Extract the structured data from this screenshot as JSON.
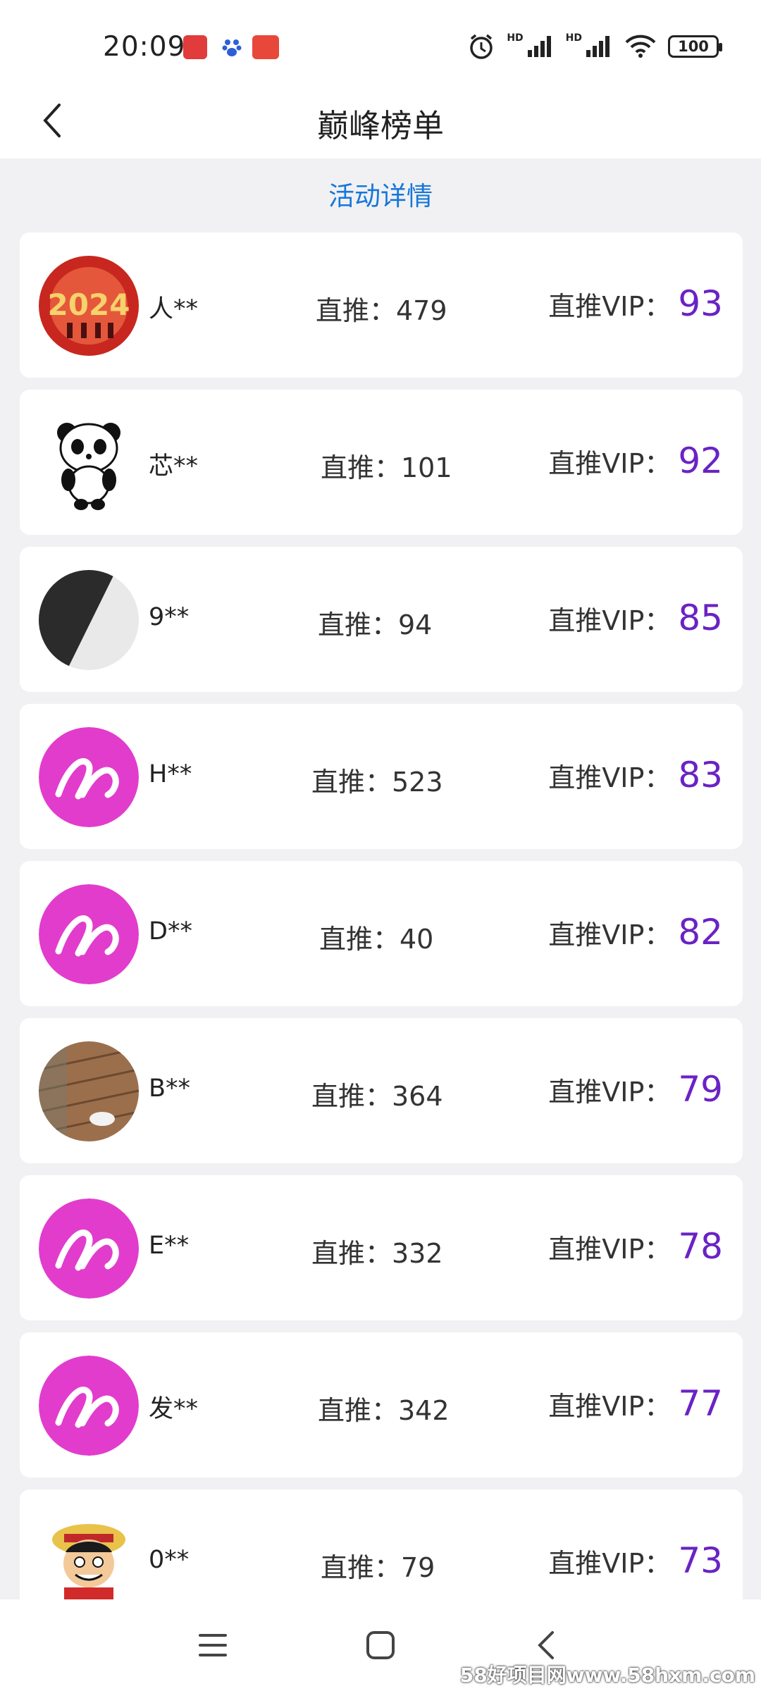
{
  "status_bar": {
    "time": "20:09",
    "battery": "100"
  },
  "header": {
    "title": "巅峰榜单"
  },
  "activity_link": "活动详情",
  "colors": {
    "vip_value": "#6a22c4",
    "link": "#1677d9",
    "avatar_pink": "#e23ccd"
  },
  "entries": [
    {
      "name": "人**",
      "direct": "直推：479",
      "vip_label": "直推VIP：",
      "vip_value": "93",
      "avatar": "image-2024"
    },
    {
      "name": "芯**",
      "direct": "直推：101",
      "vip_label": "直推VIP：",
      "vip_value": "92",
      "avatar": "panda-icon"
    },
    {
      "name": "9**",
      "direct": "直推：94",
      "vip_label": "直推VIP：",
      "vip_value": "85",
      "avatar": "photo-dark"
    },
    {
      "name": "H**",
      "direct": "直推：523",
      "vip_label": "直推VIP：",
      "vip_value": "83",
      "avatar": "pink-logo"
    },
    {
      "name": "D**",
      "direct": "直推：40",
      "vip_label": "直推VIP：",
      "vip_value": "82",
      "avatar": "pink-logo"
    },
    {
      "name": "B**",
      "direct": "直推：364",
      "vip_label": "直推VIP：",
      "vip_value": "79",
      "avatar": "photo-ground"
    },
    {
      "name": "E**",
      "direct": "直推：332",
      "vip_label": "直推VIP：",
      "vip_value": "78",
      "avatar": "pink-logo"
    },
    {
      "name": "发**",
      "direct": "直推：342",
      "vip_label": "直推VIP：",
      "vip_value": "77",
      "avatar": "pink-logo"
    },
    {
      "name": "0**",
      "direct": "直推：79",
      "vip_label": "直推VIP：",
      "vip_value": "73",
      "avatar": "cartoon-icon"
    }
  ],
  "watermark": "58好项目网www.58hxm.com"
}
